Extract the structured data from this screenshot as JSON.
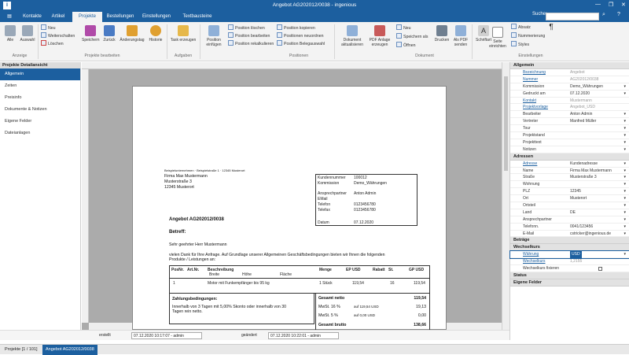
{
  "window": {
    "title": "Angebot AG202012/0038 - ingenious"
  },
  "menu": {
    "tabs": [
      "Kontakte",
      "Artikel",
      "Projekte",
      "Bestellungen",
      "Einstellungen",
      "Textbausteine"
    ],
    "search_label": "Suche:"
  },
  "ribbon": {
    "alle": "Alle",
    "auswahl": "Auswahl",
    "neu": "Neu",
    "weiterschalten": "Weiterschalten",
    "loeschen": "Löschen",
    "speichern": "Speichern",
    "zurueck": "Zurück",
    "aenderungstag": "Änderungstag",
    "historie": "Historie",
    "task_erzeugen": "Task erzeugen",
    "position_einfuegen": "Position einfügen",
    "position_loeschen": "Position löschen",
    "position_bearbeiten": "Position bearbeiten",
    "position_rekalkulieren": "Position rekalkulieren",
    "position_kopieren": "Position kopieren",
    "positionen_neuordnen": "Positionen neuordnen",
    "position_belegauswahl": "Position Belegauswahl",
    "dokument_aktualisieren": "Dokument aktualisieren",
    "pdf_anlage": "PDF Anlage erzeugen",
    "doc_neu": "Neu",
    "speichern_als": "Speichern als",
    "oeffnen": "Öffnen",
    "drucken": "Drucken",
    "als_pdf": "Als PDF senden",
    "schriftart": "Schriftart",
    "absatz": "Absatz",
    "nummerierung": "Nummerierung",
    "styles": "Styles",
    "seite_einrichten": "Seite einrichten",
    "groups": {
      "anzeige": "Anzeige",
      "projekte_bearbeiten": "Projekte bearbeiten",
      "aufgaben": "Aufgaben",
      "positionen": "Positionen",
      "dokument": "Dokument",
      "einstellungen": "Einstellungen"
    }
  },
  "leftnav": {
    "header": "Projekte Detailansicht",
    "items": [
      "Allgemein",
      "Zeiten",
      "Preisinfo",
      "Dokumente & Notizen",
      "Eigene Felder",
      "Dateianlagen"
    ]
  },
  "document": {
    "sender_line": "Beispielunternehmen · Beispielstraße 1 · 12345 Musterort",
    "recipient": [
      "Firma Max Mustermann",
      "Musterstraße 3",
      "12345 Musterort"
    ],
    "info": [
      {
        "k": "Kundennummer",
        "v": "100012"
      },
      {
        "k": "Kommission",
        "v": "Demo_Währungen"
      },
      {
        "k": "Ansprechpartner",
        "v": "Anton Admin"
      },
      {
        "k": "EMail",
        "v": ""
      },
      {
        "k": "Telefon",
        "v": "0123456780"
      },
      {
        "k": "Telefax",
        "v": "0123456780"
      },
      {
        "k": "Datum",
        "v": "07.12.2020"
      }
    ],
    "heading": "Angebot AG202012/0038",
    "betreff": "Betreff:",
    "greeting": "Sehr geehrter Herr Mustermann",
    "body1": "vielen Dank für Ihre Anfrage. Auf Grundlage unserer Allgemeinen Geschäftsbedingungen bieten wir Ihnen die folgenden",
    "body2": "Produkte / Leistungen an:",
    "table_headers": {
      "posnr": "PosNr.",
      "artnr": "Art.Nr.",
      "beschreibung": "Beschreibung",
      "breite": "Breite",
      "hoehe": "Höhe",
      "flaeche": "Fläche",
      "menge": "Menge",
      "ep": "EP USD",
      "rabatt": "Rabatt",
      "st": "St.",
      "gp": "GP USD"
    },
    "row": {
      "posnr": "1",
      "beschreibung": "Motor mit Funkempfänger bis 95 kg",
      "menge": "1 Stück",
      "ep": "119,54",
      "st": "16",
      "gp": "119,54"
    },
    "payment_title": "Zahlungsbedingungen:",
    "payment_text1": "Innerhalb von 3 Tagen mit 5,00% Skonto oder innerhalb von 30",
    "payment_text2": "Tagen rein netto.",
    "totals": {
      "netto_label": "Gesamt netto",
      "netto": "119,54",
      "mwst1_label": "MwSt. 16 %",
      "mwst1_base": "auf 119,54 USD",
      "mwst1": "19,13",
      "mwst2_label": "MwSt. 5 %",
      "mwst2_base": "auf 0,00 USD",
      "mwst2": "0,00",
      "brutto_label": "Gesamt brutto",
      "brutto": "138,66"
    }
  },
  "rightpanel": {
    "sections": {
      "allgemein": "Allgemein",
      "adressen": "Adressen",
      "betraege": "Beträge",
      "wechselkurs": "Wechselkurs",
      "status": "Status",
      "eigene_felder": "Eigene Felder"
    },
    "allgemein": [
      {
        "k": "Bezeichnung",
        "v": "Angebot",
        "link": true,
        "gray": true
      },
      {
        "k": "Nummer",
        "v": "AG202012/0038",
        "link": true,
        "gray": true
      },
      {
        "k": "Kommission",
        "v": "Demo_Währungen"
      },
      {
        "k": "Gedruckt am",
        "v": "07.12.2020"
      },
      {
        "k": "Kontakt",
        "v": "Mustermann",
        "link": true,
        "gray": true
      },
      {
        "k": "Projektvorlage",
        "v": "Angebot_USD",
        "link": true,
        "gray": true
      },
      {
        "k": "Bearbeiter",
        "v": "Anton Admin"
      },
      {
        "k": "Vertreter",
        "v": "Manfred Müller"
      },
      {
        "k": "Tour",
        "v": ""
      },
      {
        "k": "Projektstand",
        "v": ""
      },
      {
        "k": "Projekttext",
        "v": ""
      },
      {
        "k": "Notizen",
        "v": ""
      }
    ],
    "adressen": [
      {
        "k": "Adresse",
        "v": "Kundenadresse",
        "link": true
      },
      {
        "k": "Name",
        "v": "Firma Max Mustermann"
      },
      {
        "k": "Straße",
        "v": "Musterstraße 3"
      },
      {
        "k": "Wohnung",
        "v": ""
      },
      {
        "k": "PLZ",
        "v": "12345"
      },
      {
        "k": "Ort",
        "v": "Musterort"
      },
      {
        "k": "Ortsteil",
        "v": ""
      },
      {
        "k": "Land",
        "v": "DE"
      },
      {
        "k": "Ansprechpartner",
        "v": ""
      },
      {
        "k": "Telefonn.",
        "v": "0041/123456"
      },
      {
        "k": "E-Mail",
        "v": "cstricker@ingenious.de"
      }
    ],
    "wechselkurs": [
      {
        "k": "Währung",
        "v": "USD",
        "link": true
      },
      {
        "k": "Wechselkurs",
        "v": "1,2155",
        "link": true,
        "gray": true
      },
      {
        "k": "Wechselkurs fixieren",
        "v": ""
      }
    ]
  },
  "footer": {
    "erstellt_label": "erstellt",
    "erstellt": "07.12.2020 10:17:07 - admin",
    "geaendert_label": "geändert",
    "geaendert": "07.12.2020 10:22:01 - admin"
  },
  "statusbar": {
    "tab1": "Projekte [1 / 101]",
    "tab2": "Angebot AG202012/0038"
  }
}
